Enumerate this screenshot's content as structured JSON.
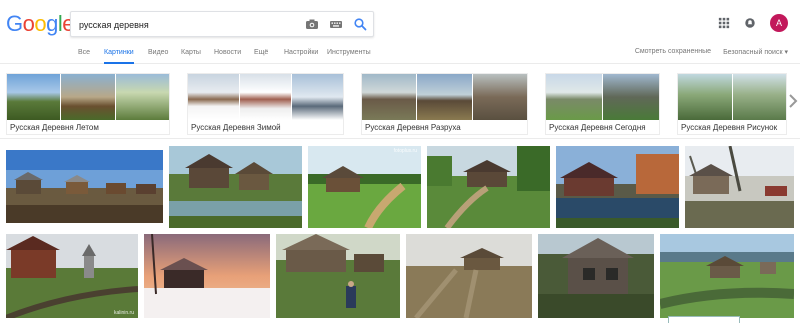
{
  "header": {
    "logo_letters": [
      "G",
      "o",
      "o",
      "g",
      "l",
      "e"
    ],
    "logo_colors": [
      "#4285f4",
      "#ea4335",
      "#fbbc05",
      "#4285f4",
      "#34a853",
      "#ea4335"
    ],
    "search_value": "русская деревня",
    "avatar_letter": "A",
    "icons": [
      "camera-icon",
      "keyboard-icon",
      "search-icon",
      "apps-grid-icon",
      "notifications-icon"
    ]
  },
  "tabs": {
    "items": [
      "Все",
      "Картинки",
      "Видео",
      "Карты",
      "Новости",
      "Ещё",
      "Настройки",
      "Инструменты"
    ],
    "active": "Картинки",
    "right_saved": "Смотреть сохраненные",
    "right_safesearch": "Безопасный поиск ▾"
  },
  "related": [
    {
      "label": "Русская Деревня Летом"
    },
    {
      "label": "Русская Деревня Зимой"
    },
    {
      "label": "Русская Деревня Разруха"
    },
    {
      "label": "Русская Деревня Сегодня"
    },
    {
      "label": "Русская Деревня Рисунок"
    }
  ],
  "watermarks": {
    "tile_3": "fotoplus.ru",
    "tile_8": "kalinin.ru"
  },
  "colors": {
    "accent": "#1a73e8",
    "tab_text": "#777777"
  }
}
